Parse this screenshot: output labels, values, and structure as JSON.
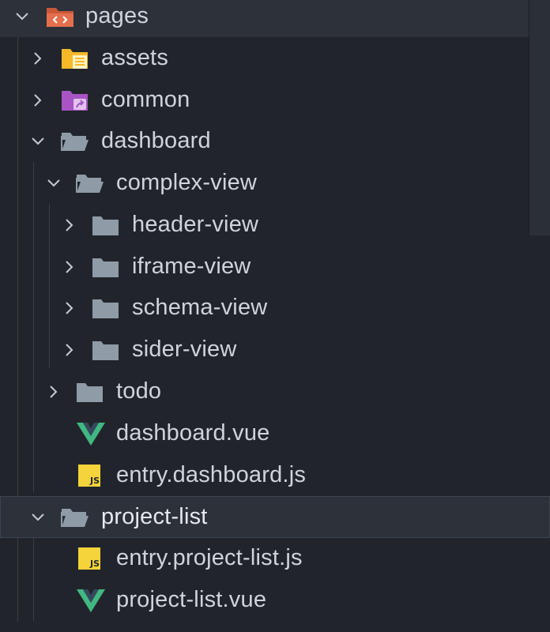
{
  "tree": {
    "pages": {
      "label": "pages",
      "icon": "pages-folder-icon",
      "expanded": true
    },
    "assets": {
      "label": "assets",
      "icon": "assets-folder-icon"
    },
    "common": {
      "label": "common",
      "icon": "common-folder-icon"
    },
    "dashboard": {
      "label": "dashboard",
      "icon": "folder-open-icon",
      "expanded": true
    },
    "complex_view": {
      "label": "complex-view",
      "icon": "folder-open-icon",
      "expanded": true
    },
    "header_view": {
      "label": "header-view",
      "icon": "folder-icon"
    },
    "iframe_view": {
      "label": "iframe-view",
      "icon": "folder-icon"
    },
    "schema_view": {
      "label": "schema-view",
      "icon": "folder-icon"
    },
    "sider_view": {
      "label": "sider-view",
      "icon": "folder-icon"
    },
    "todo": {
      "label": "todo",
      "icon": "folder-icon"
    },
    "dashboard_vue": {
      "label": "dashboard.vue",
      "icon": "vue-file-icon"
    },
    "entry_dashboard_js": {
      "label": "entry.dashboard.js",
      "icon": "js-file-icon",
      "badge": "JS"
    },
    "project_list": {
      "label": "project-list",
      "icon": "folder-open-icon",
      "expanded": true,
      "selected": true
    },
    "entry_project_list_js": {
      "label": "entry.project-list.js",
      "icon": "js-file-icon",
      "badge": "JS"
    },
    "project_list_vue": {
      "label": "project-list.vue",
      "icon": "vue-file-icon"
    }
  },
  "colors": {
    "background": "#21252b",
    "row_highlight": "#2c313a",
    "text": "#cfd4dc",
    "folder_grey": "#8f9ba7",
    "pages_folder": "#e46f4d",
    "assets_folder": "#f7b928",
    "common_folder": "#a854c4",
    "vue_green": "#41b883",
    "vue_dark": "#35495e",
    "js_yellow": "#f5d33a"
  }
}
